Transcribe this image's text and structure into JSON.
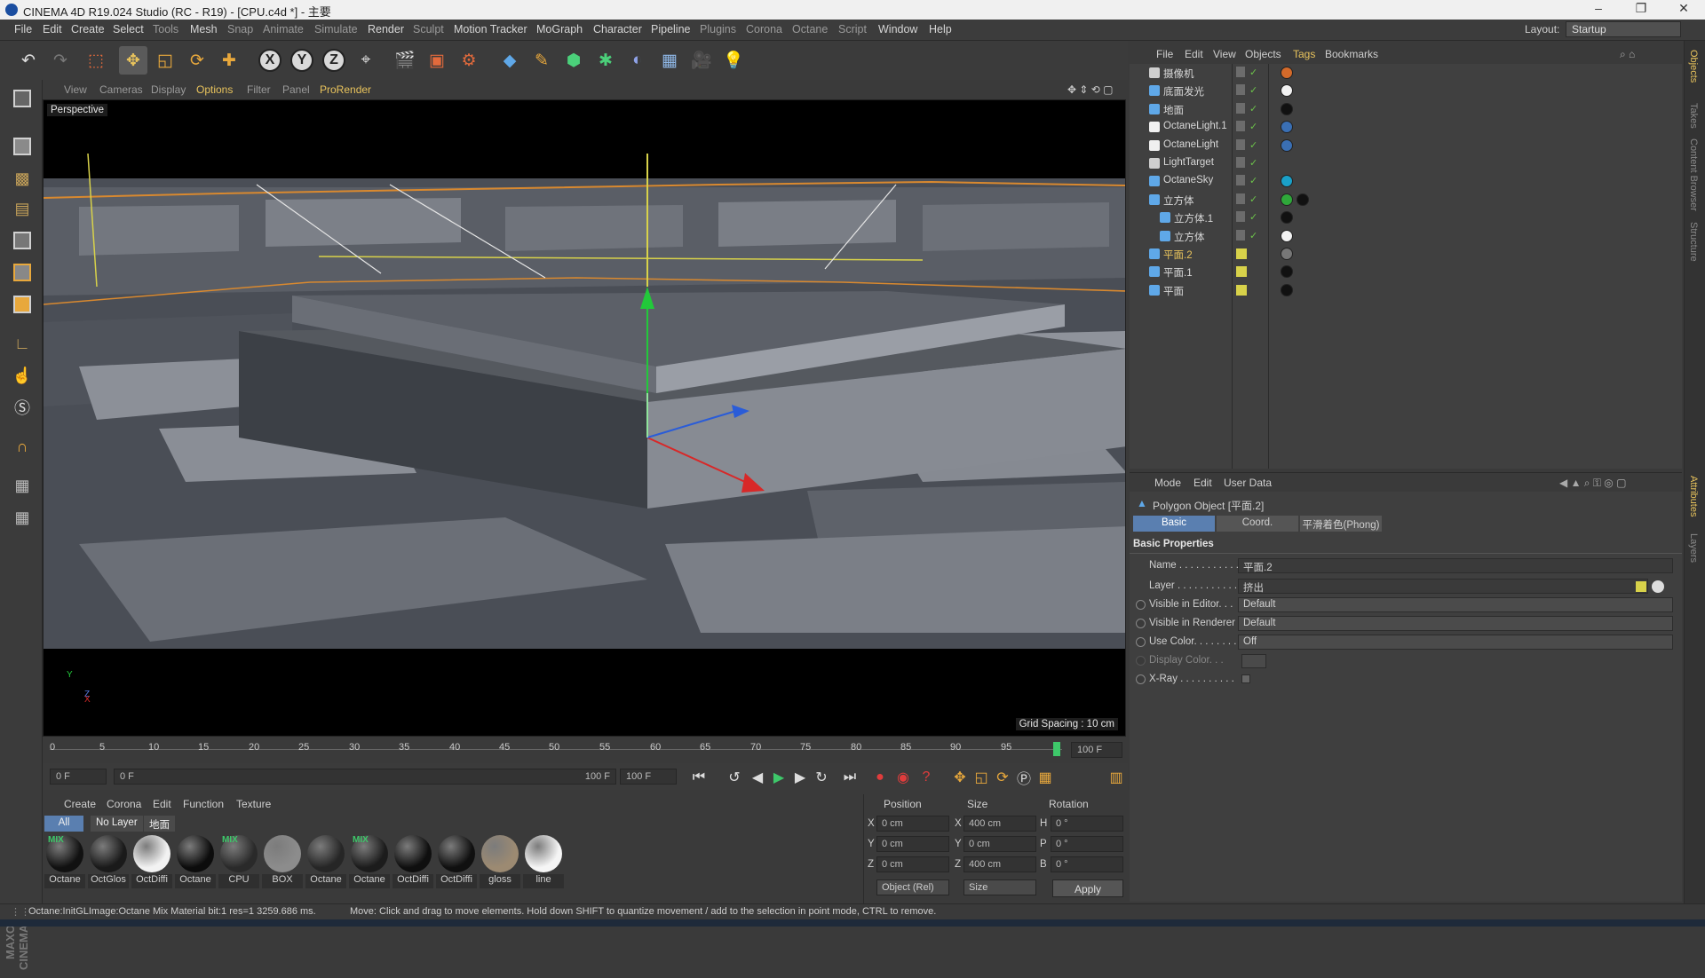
{
  "window": {
    "title": "CINEMA 4D R19.024 Studio (RC - R19) - [CPU.c4d *] - 主要",
    "controls": [
      "–",
      "❐",
      "✕"
    ]
  },
  "menubar": {
    "items": [
      "File",
      "Edit",
      "Create",
      "Select",
      "Tools",
      "Mesh",
      "Snap",
      "Animate",
      "Simulate",
      "Render",
      "Sculpt",
      "Motion Tracker",
      "MoGraph",
      "Character",
      "Pipeline",
      "Plugins",
      "Corona",
      "Octane",
      "Script",
      "Window",
      "Help"
    ],
    "layout_label": "Layout:",
    "layout_value": "Startup"
  },
  "toolbar": {
    "icons": [
      "undo-icon",
      "redo-icon",
      "live-selection-icon",
      "move-icon",
      "scale-icon",
      "rotate-icon",
      "add-icon",
      "x-axis-icon",
      "y-axis-icon",
      "z-axis-icon",
      "world-coordinates-icon",
      "render-view-icon",
      "render-picture-viewer-icon",
      "render-settings-icon",
      "cube-icon",
      "pen-icon",
      "subdivision-icon",
      "mograph-cloner-icon",
      "deformer-icon",
      "floor-icon",
      "camera-icon",
      "light-icon"
    ],
    "axis_labels": [
      "X",
      "Y",
      "Z"
    ]
  },
  "viewport": {
    "menu": [
      "View",
      "Cameras",
      "Display",
      "Options",
      "Filter",
      "Panel",
      "ProRender"
    ],
    "active_menu": "Options",
    "label": "Perspective",
    "grid_spacing": "Grid Spacing : 10 cm",
    "axis_y": "Y",
    "axis_z": "Z",
    "axis_x": "X"
  },
  "timeline": {
    "ticks": [
      "0",
      "5",
      "10",
      "15",
      "20",
      "25",
      "30",
      "35",
      "40",
      "45",
      "50",
      "55",
      "60",
      "65",
      "70",
      "75",
      "80",
      "85",
      "90",
      "95"
    ],
    "end_frame": "100 F",
    "current_frame": "0 F",
    "range_start": "0 F",
    "range_end": "100 F",
    "range_end2": "100 F"
  },
  "materials": {
    "menu": [
      "Create",
      "Corona",
      "Edit",
      "Function",
      "Texture"
    ],
    "filters": [
      "All",
      "No Layer",
      "地面"
    ],
    "items": [
      {
        "label": "Octane",
        "color": "#111111",
        "mix": true
      },
      {
        "label": "OctGlos",
        "color": "#1a1a1a",
        "mix": false
      },
      {
        "label": "OctDiffi",
        "color": "#f2f2f2",
        "mix": false
      },
      {
        "label": "Octane",
        "color": "#0c0c0c",
        "mix": false
      },
      {
        "label": "CPU",
        "color": "#2a2a2a",
        "mix": true
      },
      {
        "label": "BOX",
        "color": "#8c8c8c",
        "mix": false
      },
      {
        "label": "Octane",
        "color": "#262626",
        "mix": false
      },
      {
        "label": "Octane",
        "color": "#1c1c1c",
        "mix": true
      },
      {
        "label": "OctDiffi",
        "color": "#0f0f0f",
        "mix": false
      },
      {
        "label": "OctDiffi",
        "color": "#101010",
        "mix": false
      },
      {
        "label": "gloss",
        "color": "#9c8a72",
        "mix": false
      },
      {
        "label": "line",
        "color": "#f5f5f5",
        "mix": false
      }
    ]
  },
  "coordinates": {
    "headers": [
      "Position",
      "Size",
      "Rotation"
    ],
    "rows": [
      {
        "axis": "X",
        "pos": "0 cm",
        "size_axis": "X",
        "size": "400 cm",
        "rot_axis": "H",
        "rot": "0 °"
      },
      {
        "axis": "Y",
        "pos": "0 cm",
        "size_axis": "Y",
        "size": "0 cm",
        "rot_axis": "P",
        "rot": "0 °"
      },
      {
        "axis": "Z",
        "pos": "0 cm",
        "size_axis": "Z",
        "size": "400 cm",
        "rot_axis": "B",
        "rot": "0 °"
      }
    ],
    "mode": "Object (Rel)",
    "size_mode": "Size",
    "apply": "Apply"
  },
  "status": {
    "left": "Octane:InitGLImage:Octane Mix Material  bit:1 res=1  3259.686 ms.",
    "right": "Move: Click and drag to move elements. Hold down SHIFT to quantize movement / add to the selection in point mode, CTRL to remove."
  },
  "objects": {
    "menu": [
      "File",
      "Edit",
      "View",
      "Objects",
      "Tags",
      "Bookmarks"
    ],
    "active_menu": "Tags",
    "items": [
      {
        "name": "摄像机",
        "indent": 0,
        "type": "camera",
        "highlight": false,
        "layer": false,
        "tags": [
          "#d46a2a"
        ]
      },
      {
        "name": "底面发光",
        "indent": 0,
        "type": "object",
        "highlight": false,
        "layer": false,
        "tags": [
          "#f2f2f2"
        ]
      },
      {
        "name": "地面",
        "indent": 0,
        "type": "object",
        "highlight": false,
        "layer": false,
        "tags": [
          "#111111"
        ]
      },
      {
        "name": "OctaneLight.1",
        "indent": 0,
        "type": "light",
        "highlight": false,
        "layer": false,
        "tags": [
          "#3a6fb4"
        ]
      },
      {
        "name": "OctaneLight",
        "indent": 0,
        "type": "light",
        "highlight": false,
        "layer": false,
        "tags": [
          "#3a6fb4"
        ]
      },
      {
        "name": "LightTarget",
        "indent": 0,
        "type": "null",
        "highlight": false,
        "layer": false,
        "tags": []
      },
      {
        "name": "OctaneSky",
        "indent": 0,
        "type": "sky",
        "highlight": false,
        "layer": false,
        "tags": [
          "#1aa0c8"
        ]
      },
      {
        "name": "立方体",
        "indent": 0,
        "type": "cube",
        "highlight": false,
        "layer": false,
        "tags": [
          "#2fa83a",
          "#111111"
        ]
      },
      {
        "name": "立方体.1",
        "indent": 1,
        "type": "cube",
        "highlight": false,
        "layer": false,
        "tags": [
          "#111111"
        ]
      },
      {
        "name": "立方体",
        "indent": 1,
        "type": "cube",
        "highlight": false,
        "layer": false,
        "tags": [
          "#f2f2f2"
        ]
      },
      {
        "name": "平面.2",
        "indent": 0,
        "type": "polygon",
        "highlight": true,
        "layer": true,
        "tags": [
          "#777777"
        ]
      },
      {
        "name": "平面.1",
        "indent": 0,
        "type": "polygon",
        "highlight": false,
        "layer": true,
        "tags": [
          "#111111"
        ]
      },
      {
        "name": "平面",
        "indent": 0,
        "type": "polygon",
        "highlight": false,
        "layer": true,
        "tags": [
          "#111111"
        ]
      }
    ]
  },
  "attributes": {
    "menu": [
      "Mode",
      "Edit",
      "User Data"
    ],
    "object_title": "Polygon Object [平面.2]",
    "tabs": [
      "Basic",
      "Coord.",
      "平滑着色(Phong)"
    ],
    "active_tab": "Basic",
    "section": "Basic Properties",
    "fields": [
      {
        "label": "Name . . . . . . . . . . .",
        "value": "平面.2",
        "radio": false,
        "dim": false
      },
      {
        "label": "Layer . . . . . . . . . . .",
        "value": "挤出",
        "radio": false,
        "dim": false
      },
      {
        "label": "Visible in Editor. . .",
        "value": "Default",
        "radio": true,
        "dim": false
      },
      {
        "label": "Visible in Renderer",
        "value": "Default",
        "radio": true,
        "dim": false
      },
      {
        "label": "Use Color. . . . . . . .",
        "value": "Off",
        "radio": true,
        "dim": false
      },
      {
        "label": "Display Color. . .",
        "value": "",
        "radio": true,
        "dim": true
      },
      {
        "label": "X-Ray . . . . . . . . . .",
        "value": "",
        "radio": true,
        "dim": false
      }
    ]
  },
  "side_tabs": [
    "Objects",
    "Takes",
    "Content Browser",
    "Structure",
    "Attributes",
    "Layers"
  ],
  "colors": {
    "accent": "#e8c35c",
    "bg": "#3a3a3a",
    "panel": "#404040",
    "selected_tab": "#5a7fb0"
  }
}
